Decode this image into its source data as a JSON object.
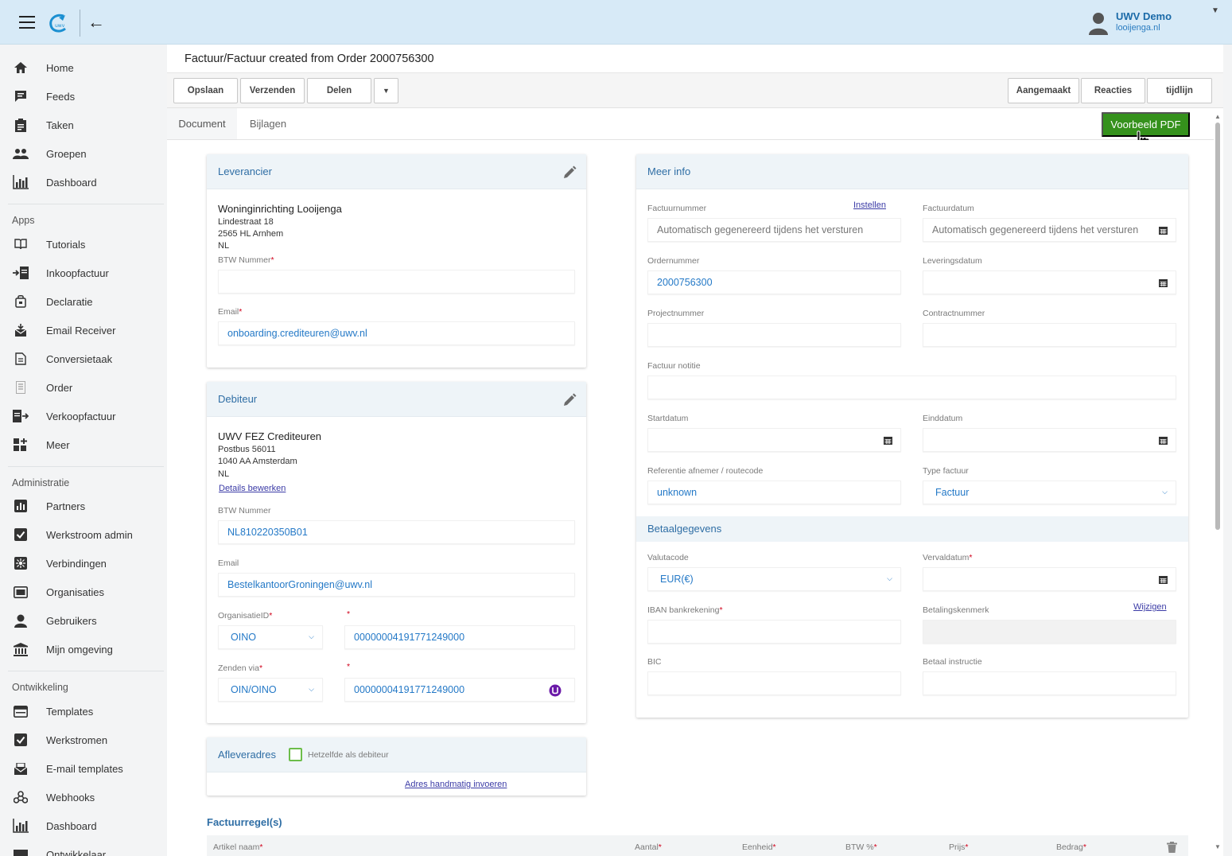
{
  "header": {
    "user_name": "UWV Demo",
    "user_domain": "looijenga.nl"
  },
  "sidebar": {
    "main": [
      {
        "label": "Home",
        "icon": "home-icon"
      },
      {
        "label": "Feeds",
        "icon": "feeds-icon"
      },
      {
        "label": "Taken",
        "icon": "tasks-icon"
      },
      {
        "label": "Groepen",
        "icon": "groups-icon"
      },
      {
        "label": "Dashboard",
        "icon": "dashboard-icon"
      }
    ],
    "apps_heading": "Apps",
    "apps": [
      {
        "label": "Tutorials",
        "icon": "book-icon"
      },
      {
        "label": "Inkoopfactuur",
        "icon": "incoming-invoice-icon"
      },
      {
        "label": "Declaratie",
        "icon": "bag-icon"
      },
      {
        "label": "Email Receiver",
        "icon": "email-receiver-icon"
      },
      {
        "label": "Conversietaak",
        "icon": "conversion-icon"
      },
      {
        "label": "Order",
        "icon": "order-icon"
      },
      {
        "label": "Verkoopfactuur",
        "icon": "outgoing-invoice-icon"
      },
      {
        "label": "Meer",
        "icon": "more-icon"
      }
    ],
    "admin_heading": "Administratie",
    "admin": [
      {
        "label": "Partners",
        "icon": "partners-icon"
      },
      {
        "label": "Werkstroom admin",
        "icon": "checkbox-icon"
      },
      {
        "label": "Verbindingen",
        "icon": "connections-icon"
      },
      {
        "label": "Organisaties",
        "icon": "organisations-icon"
      },
      {
        "label": "Gebruikers",
        "icon": "user-icon"
      },
      {
        "label": "Mijn omgeving",
        "icon": "bank-icon"
      }
    ],
    "dev_heading": "Ontwikkeling",
    "dev": [
      {
        "label": "Templates",
        "icon": "template-icon"
      },
      {
        "label": "Werkstromen",
        "icon": "checkbox-icon"
      },
      {
        "label": "E-mail templates",
        "icon": "email-template-icon"
      },
      {
        "label": "Webhooks",
        "icon": "webhooks-icon"
      },
      {
        "label": "Dashboard",
        "icon": "dashboard-icon"
      },
      {
        "label": "Ontwikkelaar",
        "icon": "developer-icon"
      }
    ]
  },
  "page": {
    "title": "Factuur/Factuur created from Order 2000756300"
  },
  "toolbar": {
    "save": "Opslaan",
    "send": "Verzenden",
    "share": "Delen",
    "created": "Aangemaakt",
    "reactions": "Reacties",
    "timeline": "tijdlijn"
  },
  "tabs": {
    "document": "Document",
    "attachments": "Bijlagen",
    "preview_pdf": "Voorbeeld PDF"
  },
  "supplier": {
    "heading": "Leverancier",
    "name": "Woninginrichting Looijenga",
    "street": "Lindestraat 18",
    "city": "2565 HL Arnhem",
    "country": "NL",
    "vat_label": "BTW Nummer",
    "vat_value": "",
    "email_label": "Email",
    "email_value": "onboarding.crediteuren@uwv.nl"
  },
  "debtor": {
    "heading": "Debiteur",
    "name": "UWV FEZ Crediteuren",
    "street": "Postbus 56011",
    "city": "1040 AA Amsterdam",
    "country": "NL",
    "edit_link": "Details bewerken",
    "vat_label": "BTW Nummer",
    "vat_value": "NL810220350B01",
    "email_label": "Email",
    "email_value": "BestelkantoorGroningen@uwv.nl",
    "org_id_label": "OrganisatieID",
    "org_id_type": "OINO",
    "org_id_value": "00000004191771249000",
    "send_via_label": "Zenden via",
    "send_via_type": "OIN/OINO",
    "send_via_value": "00000004191771249000"
  },
  "delivery": {
    "heading": "Afleveradres",
    "same_as_label": "Hetzelfde als debiteur",
    "manual_link": "Adres handmatig invoeren"
  },
  "meer_info": {
    "heading": "Meer info",
    "invoice_number_label": "Factuurnummer",
    "configure_link": "Instellen",
    "invoice_number_value": "Automatisch gegenereerd tijdens het versturen",
    "invoice_date_label": "Factuurdatum",
    "invoice_date_value": "Automatisch gegenereerd tijdens het versturen",
    "order_number_label": "Ordernummer",
    "order_number_value": "2000756300",
    "delivery_date_label": "Leveringsdatum",
    "project_number_label": "Projectnummer",
    "contract_number_label": "Contractnummer",
    "note_label": "Factuur notitie",
    "start_date_label": "Startdatum",
    "end_date_label": "Einddatum",
    "reference_label": "Referentie afnemer / routecode",
    "reference_value": "unknown",
    "invoice_type_label": "Type factuur",
    "invoice_type_value": "Factuur"
  },
  "payment": {
    "heading": "Betaalgegevens",
    "currency_label": "Valutacode",
    "currency_value": "EUR(€)",
    "due_date_label": "Vervaldatum",
    "iban_label": "IBAN bankrekening",
    "payment_ref_label": "Betalingskenmerk",
    "change_link": "Wijzigen",
    "bic_label": "BIC",
    "instruction_label": "Betaal instructie"
  },
  "invoice_lines": {
    "heading": "Factuurregel(s)",
    "columns": [
      "Artikel naam",
      "Aantal",
      "Eenheid",
      "BTW %",
      "Prijs",
      "Bedrag"
    ]
  },
  "colors": {
    "accent": "#2f6ea5",
    "primary_button": "#35911c",
    "required": "#d0021b",
    "topbar": "#d7eaf7"
  }
}
